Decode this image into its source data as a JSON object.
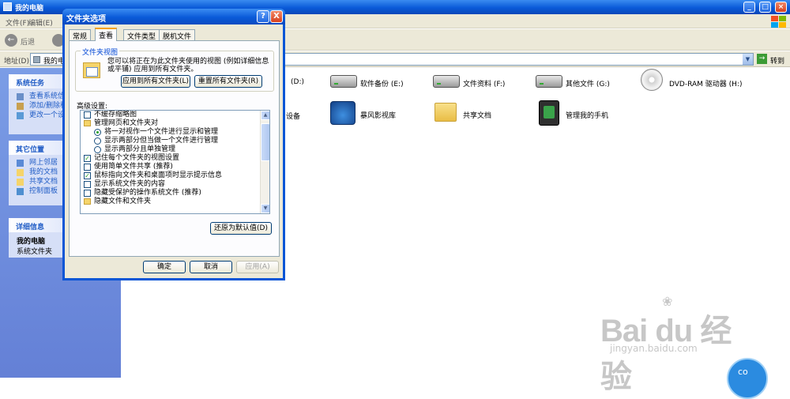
{
  "window": {
    "title": "我的电脑",
    "menu": [
      "文件(F)",
      "编辑(E)"
    ],
    "back_label": "后退",
    "address_label": "地址(D)",
    "address_value": "我的电",
    "go_label": "转到"
  },
  "sidebar": {
    "tasks": {
      "header": "系统任务",
      "items": [
        "查看系统信",
        "添加/删除程",
        "更改一个设"
      ]
    },
    "places": {
      "header": "其它位置",
      "items": [
        "网上邻居",
        "我的文档",
        "共享文档",
        "控制面板"
      ]
    },
    "details": {
      "header": "详细信息",
      "title": "我的电脑",
      "subtitle": "系统文件夹"
    }
  },
  "content": {
    "drives": [
      {
        "label": "(D:)"
      },
      {
        "label": "软件备份 (E:)"
      },
      {
        "label": "文件资料 (F:)"
      },
      {
        "label": "其他文件 (G:)"
      },
      {
        "label": "DVD-RAM 驱动器 (H:)"
      }
    ],
    "others": [
      {
        "label": "设备"
      },
      {
        "label": "暴风影视库"
      },
      {
        "label": "共享文档"
      },
      {
        "label": "管理我的手机"
      }
    ]
  },
  "dialog": {
    "title": "文件夹选项",
    "help": "?",
    "close": "X",
    "tabs": [
      "常规",
      "查看",
      "文件类型",
      "脱机文件"
    ],
    "active_tab": "查看",
    "folder_views": {
      "title": "文件夹视图",
      "description": "您可以将正在为此文件夹使用的视图 (例如详细信息或平铺) 应用到所有文件夹。",
      "apply_all": "应用到所有文件夹(L)",
      "reset_all": "重置所有文件夹(R)"
    },
    "advanced_label": "高级设置:",
    "settings": [
      {
        "label": "不缓存缩略图",
        "type": "checkbox",
        "checked": false,
        "level": 1
      },
      {
        "label": "管理网页和文件夹对",
        "type": "folder",
        "level": 1
      },
      {
        "label": "将一对视作一个文件进行显示和管理",
        "type": "radio",
        "checked": true,
        "level": 2
      },
      {
        "label": "显示两部分但当做一个文件进行管理",
        "type": "radio",
        "checked": false,
        "level": 2
      },
      {
        "label": "显示两部分且单独管理",
        "type": "radio",
        "checked": false,
        "level": 2
      },
      {
        "label": "记住每个文件夹的视图设置",
        "type": "checkbox",
        "checked": true,
        "level": 1
      },
      {
        "label": "使用简单文件共享 (推荐)",
        "type": "checkbox",
        "checked": false,
        "level": 1
      },
      {
        "label": "鼠标指向文件夹和桌面项时显示提示信息",
        "type": "checkbox",
        "checked": true,
        "level": 1
      },
      {
        "label": "显示系统文件夹的内容",
        "type": "checkbox",
        "checked": false,
        "level": 1
      },
      {
        "label": "隐藏受保护的操作系统文件 (推荐)",
        "type": "checkbox",
        "checked": false,
        "level": 1
      },
      {
        "label": "隐藏文件和文件夹",
        "type": "folder",
        "level": 1
      }
    ],
    "restore_defaults": "还原为默认值(D)",
    "ok": "确定",
    "cancel": "取消",
    "apply": "应用(A)"
  },
  "watermark": {
    "brand": "Bai du 经验",
    "url": "jingyan.baidu.com",
    "badge": "co"
  }
}
